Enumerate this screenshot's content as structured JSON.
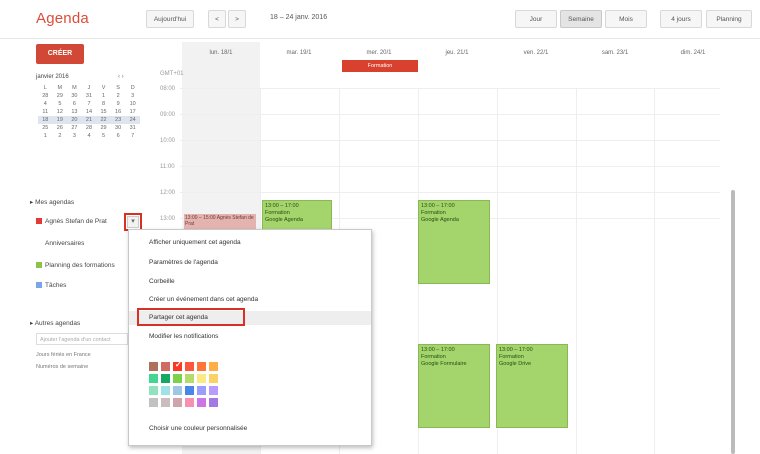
{
  "app": {
    "title": "Agenda"
  },
  "header": {
    "today_label": "Aujourd'hui",
    "prev_label": "<",
    "next_label": ">",
    "date_range": "18 – 24 janv. 2016",
    "views": [
      "Jour",
      "Semaine",
      "Mois",
      "4 jours",
      "Planning"
    ]
  },
  "sidebar": {
    "create_label": "CRÉER",
    "mini_month": "janvier 2016",
    "mini_nav": "‹ ›",
    "mini_days": [
      "L",
      "M",
      "M",
      "J",
      "V",
      "S",
      "D"
    ],
    "mini_weeks": [
      [
        "28",
        "29",
        "30",
        "31",
        "1",
        "2",
        "3"
      ],
      [
        "4",
        "5",
        "6",
        "7",
        "8",
        "9",
        "10"
      ],
      [
        "11",
        "12",
        "13",
        "14",
        "15",
        "16",
        "17"
      ],
      [
        "18",
        "19",
        "20",
        "21",
        "22",
        "23",
        "24"
      ],
      [
        "25",
        "26",
        "27",
        "28",
        "29",
        "30",
        "31"
      ],
      [
        "1",
        "2",
        "3",
        "4",
        "5",
        "6",
        "7"
      ]
    ],
    "my_calendars_label": "▸ Mes agendas",
    "calendars": [
      {
        "label": "Agnès Stefan de Prat",
        "color": "#e53935"
      },
      {
        "label": "Anniversaires",
        "color": ""
      },
      {
        "label": "Planning des formations",
        "color": "#8bc34a"
      },
      {
        "label": "Tâches",
        "color": "#7aa6e8"
      }
    ],
    "other_calendars_label": "▸ Autres agendas",
    "other_input_placeholder": "Ajouter l'agenda d'un contact",
    "other_calendars": [
      "Jours fériés en France",
      "Numéros de semaine"
    ]
  },
  "grid": {
    "day_headers": [
      "lun. 18/1",
      "mar. 19/1",
      "mer. 20/1",
      "jeu. 21/1",
      "ven. 22/1",
      "sam. 23/1",
      "dim. 24/1"
    ],
    "gmt_label": "GMT+01",
    "hours": [
      "08:00",
      "09:00",
      "10:00",
      "11:00",
      "12:00",
      "13:00"
    ],
    "all_day_event": "Formation",
    "events": [
      {
        "time": "13:00 – 17:00",
        "title": "Formation",
        "desc": "Google Agenda"
      },
      {
        "time": "13:00 – 17:00",
        "title": "Formation",
        "desc": "Google Agenda"
      },
      {
        "time": "13:00 – 17:00",
        "title": "Formation",
        "desc": "Google Formulaire"
      },
      {
        "time": "13:00 – 17:00",
        "title": "Formation",
        "desc": "Google Drive"
      }
    ],
    "pink_event": "13:00 – 15:00 Agnès Stefan de Prat"
  },
  "menu": {
    "items": [
      "Afficher uniquement cet agenda",
      "Paramètres de l'agenda",
      "Corbeille",
      "Créer un événement dans cet agenda",
      "Partager cet agenda",
      "Modifier les notifications"
    ],
    "custom_color": "Choisir une couleur personnalisée",
    "palette": [
      [
        "#ac725e",
        "#d06b64",
        "#f83a22",
        "#fa573c",
        "#ff7537",
        "#ffad46"
      ],
      [
        "#42d692",
        "#16a765",
        "#7bd148",
        "#b3dc6c",
        "#fbe983",
        "#fad165"
      ],
      [
        "#92e1c0",
        "#9fe1e7",
        "#9fc6e7",
        "#4986e7",
        "#9a9cff",
        "#b99aff"
      ],
      [
        "#c2c2c2",
        "#cabdbf",
        "#cca6ac",
        "#f691b2",
        "#cd74e6",
        "#a47ae2"
      ]
    ]
  }
}
